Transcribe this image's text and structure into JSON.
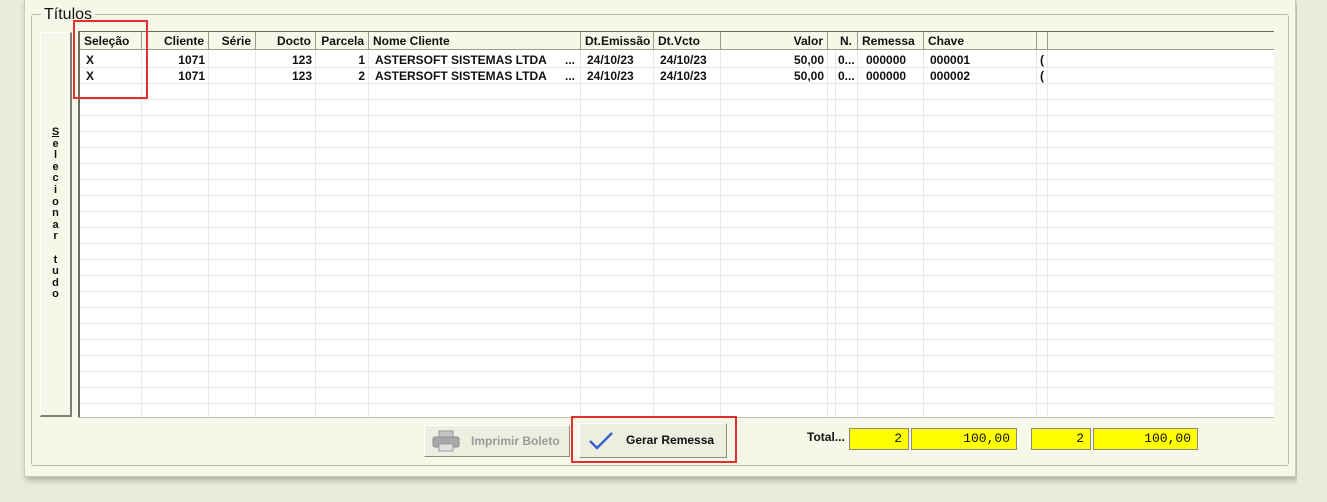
{
  "group_title": "Títulos",
  "select_all_label": "Selecionar tudo",
  "columns": [
    {
      "key": "selecao",
      "label": "Seleção"
    },
    {
      "key": "cliente",
      "label": "Cliente"
    },
    {
      "key": "serie",
      "label": "Série"
    },
    {
      "key": "docto",
      "label": "Docto"
    },
    {
      "key": "parcela",
      "label": "Parcela"
    },
    {
      "key": "nome",
      "label": "Nome Cliente"
    },
    {
      "key": "emissao",
      "label": "Dt.Emissão"
    },
    {
      "key": "vcto",
      "label": "Dt.Vcto"
    },
    {
      "key": "valor",
      "label": "Valor"
    },
    {
      "key": "n",
      "label": "N."
    },
    {
      "key": "remessa",
      "label": "Remessa"
    },
    {
      "key": "chave",
      "label": "Chave"
    }
  ],
  "rows": [
    {
      "selecao": "X",
      "cliente": "1071",
      "serie": "",
      "docto": "123",
      "parcela": "1",
      "nome": "ASTERSOFT SISTEMAS LTDA",
      "nome_more": "...",
      "emissao": "24/10/23",
      "vcto": "24/10/23",
      "valor": "50,00",
      "n": "0...",
      "remessa": "000000",
      "chave": "000001",
      "extra": "("
    },
    {
      "selecao": "X",
      "cliente": "1071",
      "serie": "",
      "docto": "123",
      "parcela": "2",
      "nome": "ASTERSOFT SISTEMAS LTDA",
      "nome_more": "...",
      "emissao": "24/10/23",
      "vcto": "24/10/23",
      "valor": "50,00",
      "n": "0...",
      "remessa": "000000",
      "chave": "000002",
      "extra": "("
    }
  ],
  "buttons": {
    "imprimir": "Imprimir Boleto",
    "gerar": "Gerar Remessa"
  },
  "totals": {
    "label": "Total...",
    "count1": "2",
    "value1": "100,00",
    "count2": "2",
    "value2": "100,00"
  },
  "colors": {
    "highlight_field": "#ffff00",
    "annotation_red": "#e03030",
    "check_blue": "#3a5fcd"
  }
}
